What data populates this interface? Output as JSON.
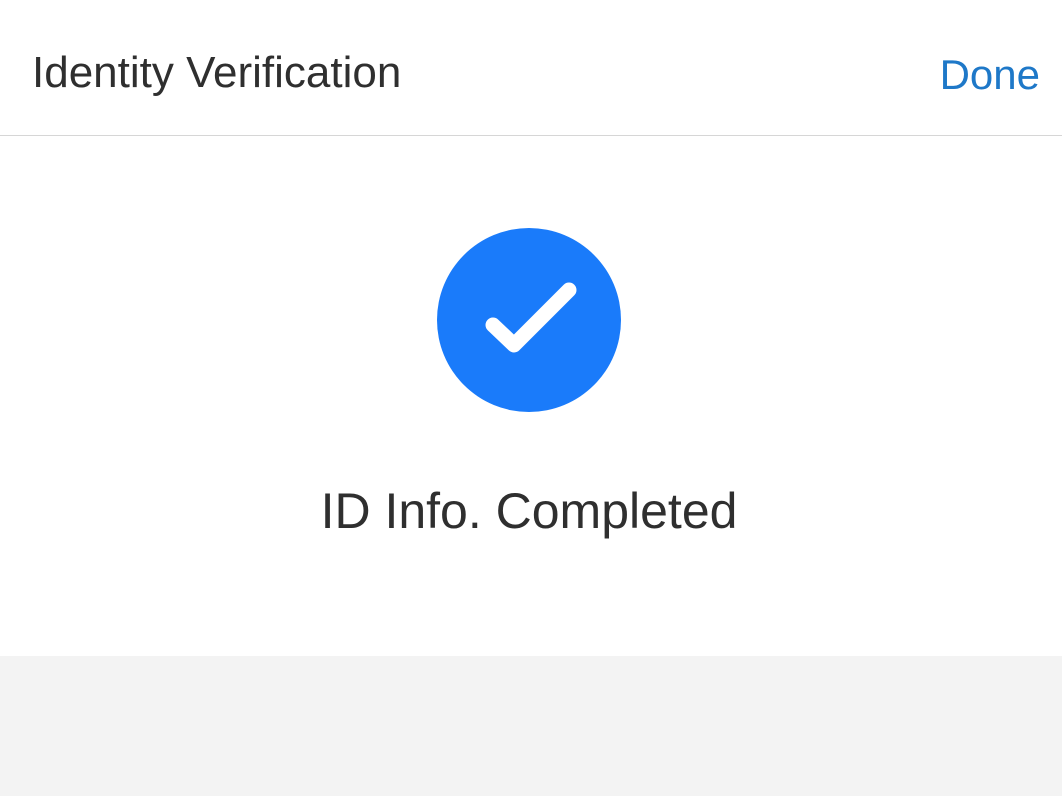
{
  "header": {
    "title": "Identity Verification",
    "done_label": "Done"
  },
  "main": {
    "status_icon": "check-circle-icon",
    "status_text": "ID Info. Completed"
  },
  "colors": {
    "accent": "#1a7bfa",
    "link": "#1e78c8",
    "text": "#2f2f2f",
    "footer_bg": "#f3f3f3"
  }
}
